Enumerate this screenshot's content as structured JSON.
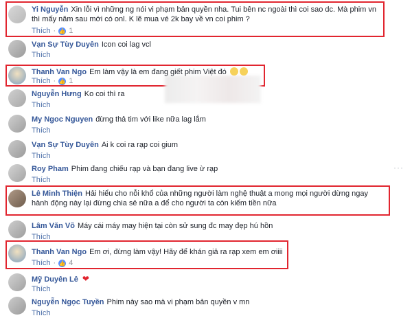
{
  "ui": {
    "like_label": "Thích",
    "separator": "·",
    "more_icon": "more-icon",
    "colors": {
      "author": "#365899",
      "highlight": "#e1252f",
      "like_badge": "#5890ff"
    }
  },
  "comments": [
    {
      "author": "Yi Nguyễn",
      "text": "Xin lỗi vì những ng nói vi phạm bản quyền nha. Tui bên nc ngoài thì coi sao dc. Mà phim vn thì mấy năm sau mới có onl. K lẽ mua vé 2k bay về vn coi phim ?",
      "likes": "1"
    },
    {
      "author": "Vạn Sự Tùy Duyên",
      "text": "Icon coi lag vcl"
    },
    {
      "author": "Thanh Van Ngo",
      "text": "Em làm vậy là em đang giết phim Việt đó",
      "likes": "1"
    },
    {
      "author": "Nguyễn Hưng",
      "text": "Ko coi thì ra"
    },
    {
      "author": "My Ngoc Nguyen",
      "text": "đừng thả tim với like nữa lag lắm"
    },
    {
      "author": "Vạn Sự Tùy Duyên",
      "text": "Ai k coi ra rạp coi gium"
    },
    {
      "author": "Roy Pham",
      "text": "Phim đang chiếu rạp và bạn đang live ừ rạp"
    },
    {
      "author": "Lê Minh Thiện",
      "text": "Hải hiểu cho nỗi khổ của những người làm nghệ thuật a mong mọi người dừng ngay hành động này lại đừng chia sẻ nữa a để cho người ta còn kiếm tiền nữa"
    },
    {
      "author": "Lâm Văn Võ",
      "text": "Máy cái máy may hiện tại còn sử sung đc may đẹp hú hồn"
    },
    {
      "author": "Thanh Van Ngo",
      "text": "Em ơi, đừng làm vậy! Hãy để khán giả ra rạp xem em ơiiii",
      "likes": "4"
    },
    {
      "author": "Mỹ Duyên Lê",
      "text": ""
    },
    {
      "author": "Nguyễn Ngọc Tuyền",
      "text": "Phim này sao mà vi phạm bản quyền v mn"
    }
  ]
}
